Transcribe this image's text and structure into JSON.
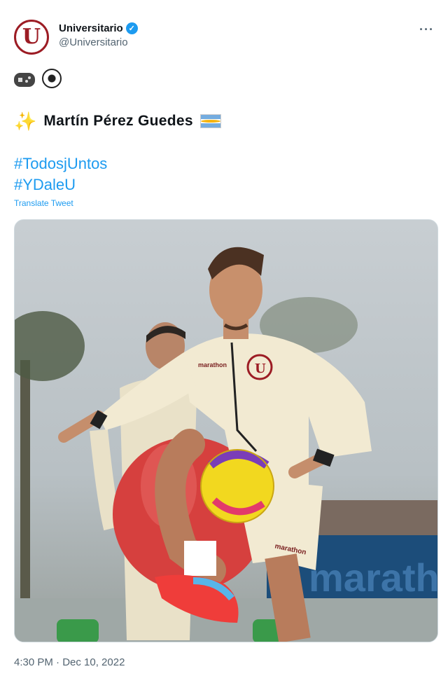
{
  "tweet": {
    "display_name": "Universitario",
    "handle": "@Universitario",
    "verified_icon": "verified-badge-icon",
    "more_icon": "more-options-icon",
    "avatar_letter": "U",
    "emoji_line": [
      "video-game-icon",
      "soccer-ball-icon"
    ],
    "player_name": "Martín Pérez Guedes",
    "sparkle_icon": "sparkles-icon",
    "flag_icon": "argentina-flag-icon",
    "hashtags": [
      "#TodosjUntos",
      "#YDaleU"
    ],
    "translate_label": "Translate Tweet",
    "image": {
      "jersey_brand": "marathon",
      "crest_letter": "U",
      "background_sign": "marathon"
    },
    "timestamp": "4:30 PM · Dec 10, 2022"
  },
  "colors": {
    "brand": "#9c1c24",
    "link": "#1d9bf0",
    "secondary_text": "#536471"
  }
}
